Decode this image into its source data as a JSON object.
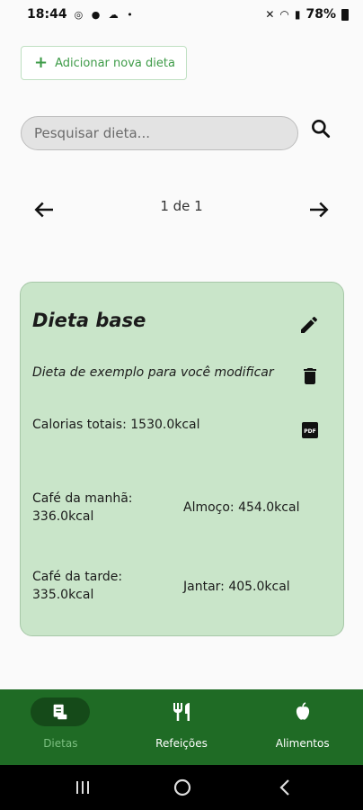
{
  "status_bar": {
    "time": "18:44",
    "left_icons": [
      "instagram-icon",
      "app-icon",
      "cloud-icon",
      "dot-icon"
    ],
    "right_icons": [
      "mute-icon",
      "wifi-icon",
      "signal-icon"
    ],
    "battery": "78%"
  },
  "header": {
    "add_button_label": "Adicionar nova dieta"
  },
  "search": {
    "placeholder": "Pesquisar dieta..."
  },
  "pagination": {
    "label": "1 de 1"
  },
  "diet_card": {
    "title": "Dieta base",
    "description": "Dieta de exemplo para você modificar",
    "total_calories": "Calorias totais: 1530.0kcal",
    "meals": [
      {
        "label": "Café da manhã: 336.0kcal"
      },
      {
        "label": "Almoço: 454.0kcal"
      },
      {
        "label": "Café da tarde: 335.0kcal"
      },
      {
        "label": "Jantar: 405.0kcal"
      }
    ]
  },
  "bottom_nav": {
    "items": [
      {
        "label": "Dietas",
        "icon": "diet-icon",
        "active": true
      },
      {
        "label": "Refeições",
        "icon": "fork-knife-icon",
        "active": false
      },
      {
        "label": "Alimentos",
        "icon": "apple-icon",
        "active": false
      }
    ]
  },
  "colors": {
    "accent": "#1f6b25",
    "card_background": "#c9e5c9",
    "button_text": "#3e9b48",
    "active_nav_label": "#7cbf80"
  }
}
